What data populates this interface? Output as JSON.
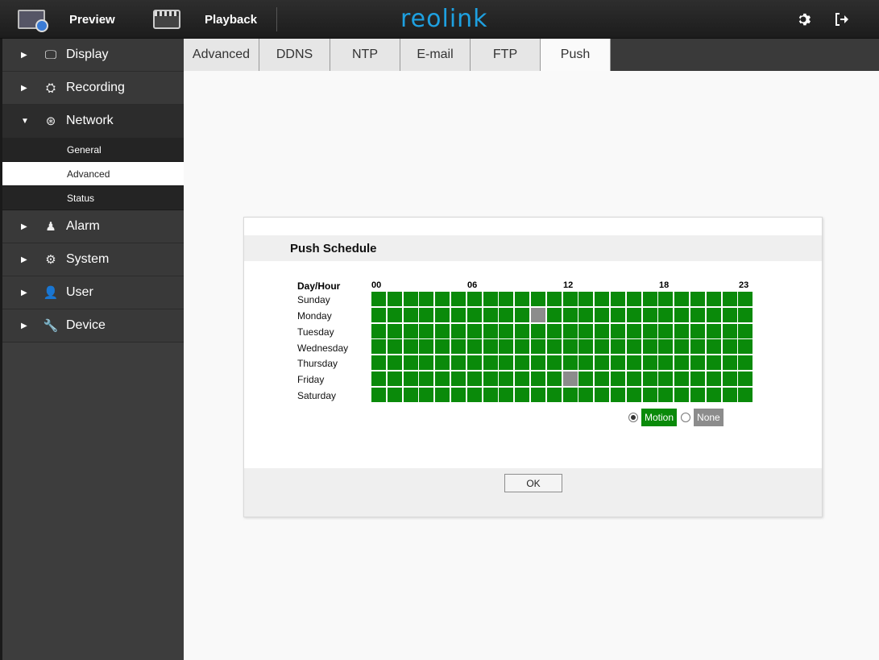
{
  "topbar": {
    "preview_label": "Preview",
    "playback_label": "Playback",
    "logo_text": "reolink",
    "logo_color": "#1ea0e0"
  },
  "sidebar": {
    "items": [
      {
        "label": "Display",
        "icon": "monitor-icon",
        "expanded": false
      },
      {
        "label": "Recording",
        "icon": "camera-icon",
        "expanded": false
      },
      {
        "label": "Network",
        "icon": "globe-icon",
        "expanded": true,
        "children": [
          "General",
          "Advanced",
          "Status"
        ],
        "active_child": "Advanced"
      },
      {
        "label": "Alarm",
        "icon": "alarm-icon",
        "expanded": false
      },
      {
        "label": "System",
        "icon": "gears-icon",
        "expanded": false
      },
      {
        "label": "User",
        "icon": "user-icon",
        "expanded": false
      },
      {
        "label": "Device",
        "icon": "wrench-icon",
        "expanded": false
      }
    ]
  },
  "tabs": {
    "items": [
      "Advanced",
      "DDNS",
      "NTP",
      "E-mail",
      "FTP",
      "Push"
    ],
    "active": "Push"
  },
  "panel": {
    "title": "Push Schedule",
    "day_hour_label": "Day/Hour",
    "hour_marks": [
      "00",
      "06",
      "12",
      "18",
      "23"
    ],
    "days": [
      "Sunday",
      "Monday",
      "Tuesday",
      "Wednesday",
      "Thursday",
      "Friday",
      "Saturday"
    ],
    "hours_per_day": 24,
    "none_slots": [
      {
        "day": "Monday",
        "hour": 10
      },
      {
        "day": "Friday",
        "hour": 12
      }
    ],
    "legend": {
      "motion_label": "Motion",
      "none_label": "None",
      "selected": "Motion"
    },
    "ok_label": "OK"
  },
  "colors": {
    "motion": "#0a8a0a",
    "none": "#8c8c8c"
  }
}
